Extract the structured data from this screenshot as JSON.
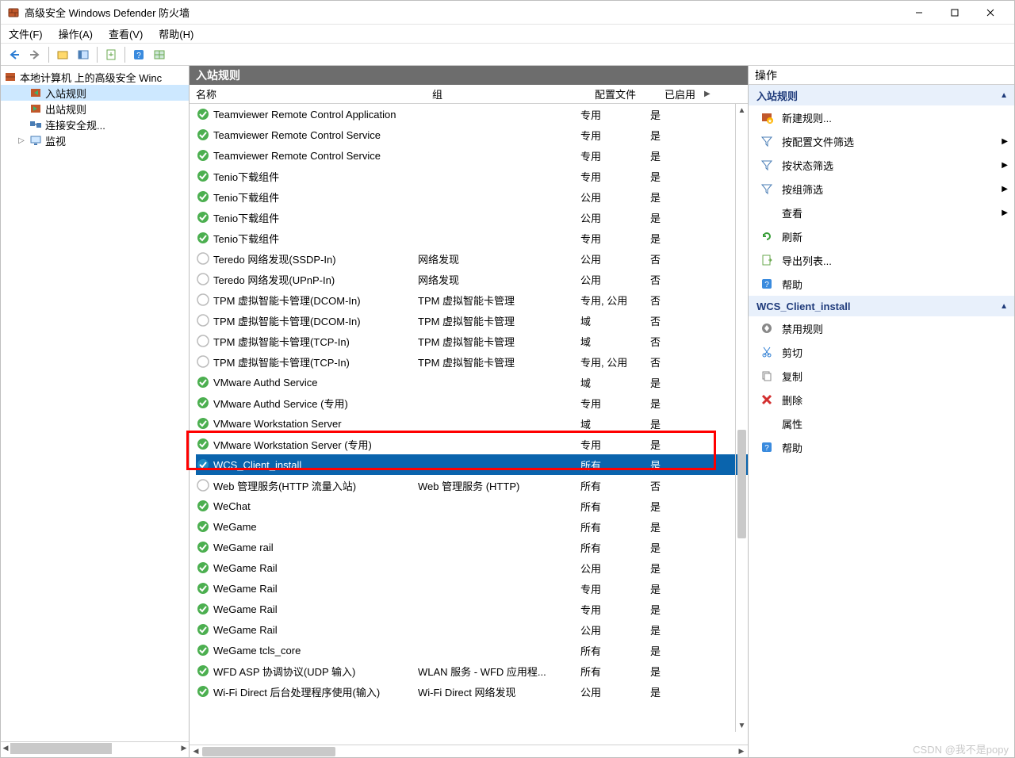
{
  "title": "高级安全 Windows Defender 防火墙",
  "menu": {
    "file": "文件(F)",
    "action": "操作(A)",
    "view": "查看(V)",
    "help": "帮助(H)"
  },
  "tree": {
    "root": "本地计算机 上的高级安全 Winc",
    "items": [
      {
        "label": "入站规则",
        "icon": "inbound"
      },
      {
        "label": "出站规则",
        "icon": "outbound"
      },
      {
        "label": "连接安全规...",
        "icon": "connection"
      },
      {
        "label": "监视",
        "icon": "monitor",
        "expandable": true
      }
    ]
  },
  "center": {
    "title": "入站规则",
    "columns": {
      "name": "名称",
      "group": "组",
      "profile": "配置文件",
      "enabled": "已启用"
    },
    "rows": [
      {
        "icon": "on",
        "name": "Teamviewer Remote Control Application",
        "group": "",
        "profile": "专用",
        "enabled": "是"
      },
      {
        "icon": "on",
        "name": "Teamviewer Remote Control Service",
        "group": "",
        "profile": "专用",
        "enabled": "是"
      },
      {
        "icon": "on",
        "name": "Teamviewer Remote Control Service",
        "group": "",
        "profile": "专用",
        "enabled": "是"
      },
      {
        "icon": "on",
        "name": "Tenio下载组件",
        "group": "",
        "profile": "专用",
        "enabled": "是"
      },
      {
        "icon": "on",
        "name": "Tenio下载组件",
        "group": "",
        "profile": "公用",
        "enabled": "是"
      },
      {
        "icon": "on",
        "name": "Tenio下载组件",
        "group": "",
        "profile": "公用",
        "enabled": "是"
      },
      {
        "icon": "on",
        "name": "Tenio下载组件",
        "group": "",
        "profile": "专用",
        "enabled": "是"
      },
      {
        "icon": "off",
        "name": "Teredo 网络发现(SSDP-In)",
        "group": "网络发现",
        "profile": "公用",
        "enabled": "否"
      },
      {
        "icon": "off",
        "name": "Teredo 网络发现(UPnP-In)",
        "group": "网络发现",
        "profile": "公用",
        "enabled": "否"
      },
      {
        "icon": "off",
        "name": "TPM 虚拟智能卡管理(DCOM-In)",
        "group": "TPM 虚拟智能卡管理",
        "profile": "专用, 公用",
        "enabled": "否"
      },
      {
        "icon": "off",
        "name": "TPM 虚拟智能卡管理(DCOM-In)",
        "group": "TPM 虚拟智能卡管理",
        "profile": "域",
        "enabled": "否"
      },
      {
        "icon": "off",
        "name": "TPM 虚拟智能卡管理(TCP-In)",
        "group": "TPM 虚拟智能卡管理",
        "profile": "域",
        "enabled": "否"
      },
      {
        "icon": "off",
        "name": "TPM 虚拟智能卡管理(TCP-In)",
        "group": "TPM 虚拟智能卡管理",
        "profile": "专用, 公用",
        "enabled": "否"
      },
      {
        "icon": "on",
        "name": "VMware Authd Service",
        "group": "",
        "profile": "域",
        "enabled": "是"
      },
      {
        "icon": "on",
        "name": "VMware Authd Service (专用)",
        "group": "",
        "profile": "专用",
        "enabled": "是"
      },
      {
        "icon": "on",
        "name": "VMware Workstation Server",
        "group": "",
        "profile": "域",
        "enabled": "是"
      },
      {
        "icon": "on",
        "name": "VMware Workstation Server (专用)",
        "group": "",
        "profile": "专用",
        "enabled": "是"
      },
      {
        "icon": "sel",
        "name": "WCS_Client_install",
        "group": "",
        "profile": "所有",
        "enabled": "是",
        "selected": true
      },
      {
        "icon": "off",
        "name": "Web 管理服务(HTTP 流量入站)",
        "group": "Web 管理服务 (HTTP)",
        "profile": "所有",
        "enabled": "否"
      },
      {
        "icon": "on",
        "name": "WeChat",
        "group": "",
        "profile": "所有",
        "enabled": "是"
      },
      {
        "icon": "on",
        "name": "WeGame",
        "group": "",
        "profile": "所有",
        "enabled": "是"
      },
      {
        "icon": "on",
        "name": "WeGame rail",
        "group": "",
        "profile": "所有",
        "enabled": "是"
      },
      {
        "icon": "on",
        "name": "WeGame Rail",
        "group": "",
        "profile": "公用",
        "enabled": "是"
      },
      {
        "icon": "on",
        "name": "WeGame Rail",
        "group": "",
        "profile": "专用",
        "enabled": "是"
      },
      {
        "icon": "on",
        "name": "WeGame Rail",
        "group": "",
        "profile": "专用",
        "enabled": "是"
      },
      {
        "icon": "on",
        "name": "WeGame Rail",
        "group": "",
        "profile": "公用",
        "enabled": "是"
      },
      {
        "icon": "on",
        "name": "WeGame tcls_core",
        "group": "",
        "profile": "所有",
        "enabled": "是"
      },
      {
        "icon": "on",
        "name": "WFD ASP 协调协议(UDP 输入)",
        "group": "WLAN 服务 - WFD 应用程...",
        "profile": "所有",
        "enabled": "是"
      },
      {
        "icon": "on",
        "name": "Wi-Fi Direct 后台处理程序使用(输入)",
        "group": "Wi-Fi Direct 网络发现",
        "profile": "公用",
        "enabled": "是"
      }
    ]
  },
  "actions": {
    "title": "操作",
    "section1_title": "入站规则",
    "section1": [
      {
        "icon": "newrule",
        "label": "新建规则...",
        "arrow": false
      },
      {
        "icon": "filter",
        "label": "按配置文件筛选",
        "arrow": true
      },
      {
        "icon": "filter",
        "label": "按状态筛选",
        "arrow": true
      },
      {
        "icon": "filter",
        "label": "按组筛选",
        "arrow": true
      },
      {
        "icon": "none",
        "label": "查看",
        "arrow": true
      },
      {
        "icon": "refresh",
        "label": "刷新",
        "arrow": false
      },
      {
        "icon": "export",
        "label": "导出列表...",
        "arrow": false
      },
      {
        "icon": "help",
        "label": "帮助",
        "arrow": false
      }
    ],
    "section2_title": "WCS_Client_install",
    "section2": [
      {
        "icon": "disable",
        "label": "禁用规则"
      },
      {
        "icon": "cut",
        "label": "剪切"
      },
      {
        "icon": "copy",
        "label": "复制"
      },
      {
        "icon": "delete",
        "label": "删除"
      },
      {
        "icon": "none",
        "label": "属性"
      },
      {
        "icon": "help",
        "label": "帮助"
      }
    ]
  },
  "watermark": "CSDN @我不是popy"
}
